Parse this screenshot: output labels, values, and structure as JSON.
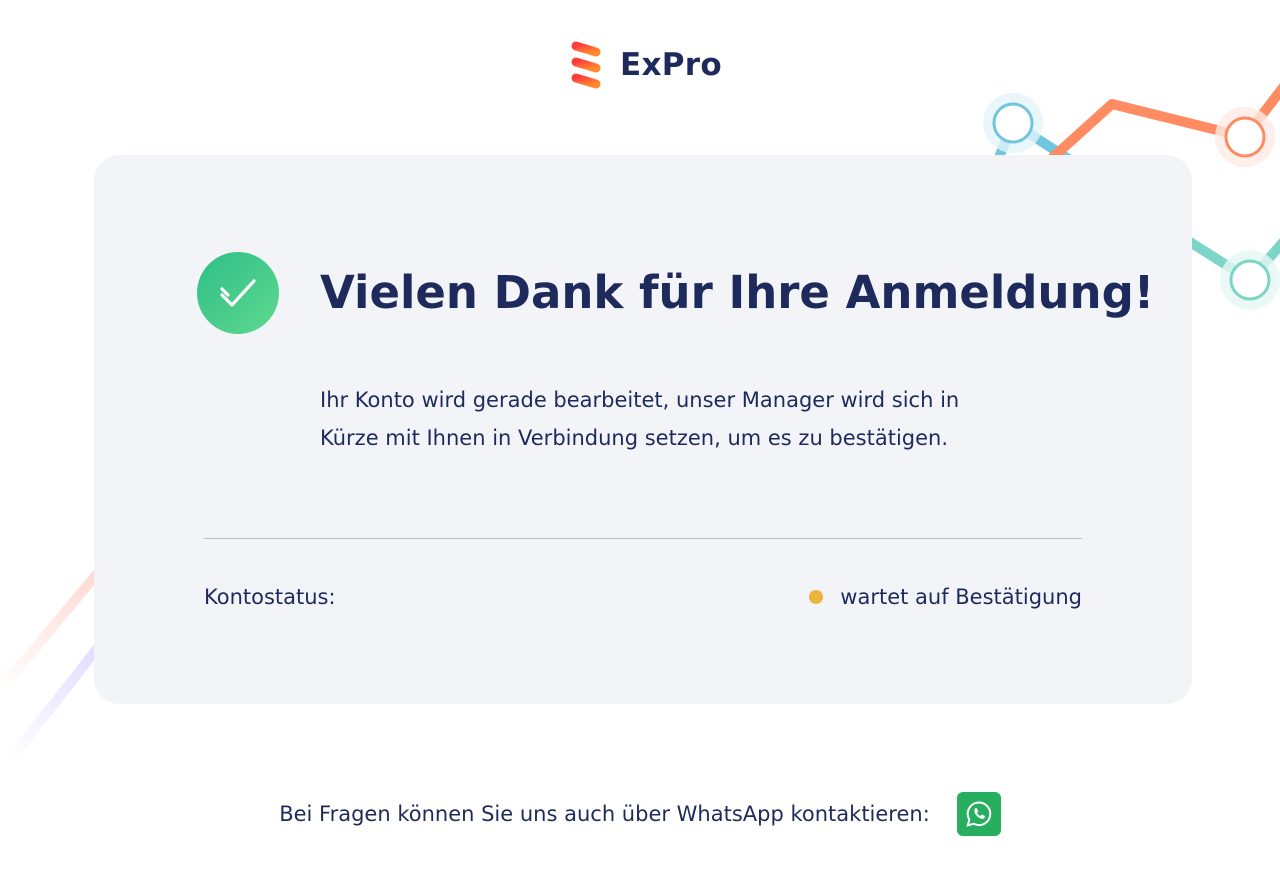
{
  "brand": {
    "name": "ExPro",
    "colors": {
      "primary_text": "#1f2a5c",
      "accent_orange": "#ff5a2c",
      "success_green": "#2fbe87",
      "pending_yellow": "#ecb43c",
      "whatsapp_green": "#27ae5f"
    }
  },
  "card": {
    "title": "Vielen Dank für Ihre Anmeldung!",
    "message": "Ihr Konto wird gerade bearbeitet, unser Manager wird sich in Kürze mit Ihnen in Verbindung setzen, um es zu bestätigen.",
    "status_label": "Kontostatus:",
    "status_value": "wartet auf Bestätigung",
    "icons": {
      "success": "check-icon",
      "status": "status-dot"
    }
  },
  "footer": {
    "text": "Bei Fragen können Sie uns auch über WhatsApp kontaktieren:",
    "button_icon": "whatsapp-icon"
  }
}
